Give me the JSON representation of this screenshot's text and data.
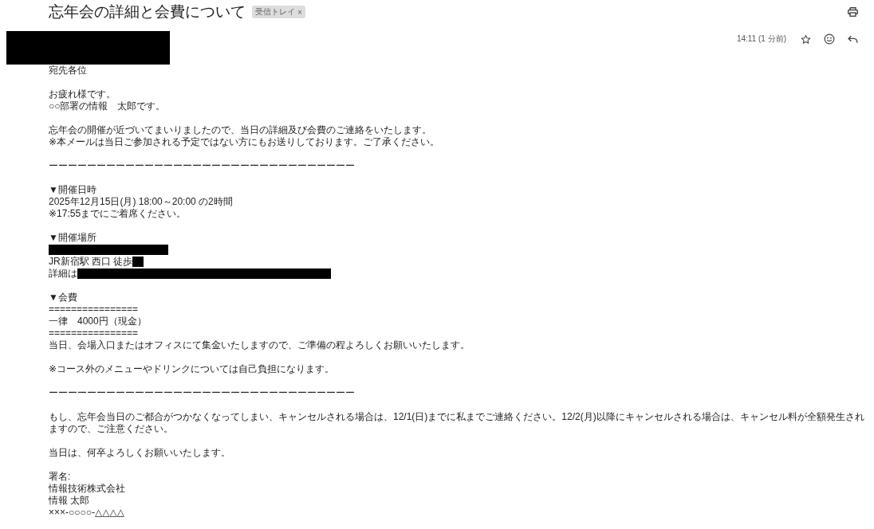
{
  "subject": "忘年会の詳細と会費について",
  "tag": {
    "label": "受信トレイ",
    "remove": "×"
  },
  "sender": {
    "redacted": true
  },
  "time": "14:11 (1 分前)",
  "starred": false,
  "body": [
    [
      {
        "text": "宛先各位"
      }
    ],
    [
      {
        "text": "お疲れ様です。"
      },
      {
        "text": "○○部署の情報　太郎です。"
      }
    ],
    [
      {
        "text": "忘年会の開催が近づいてまいりましたので、当日の詳細及び会費のご連絡をいたします。"
      },
      {
        "text": "※本メールは当日ご参加される予定ではない方にもお送りしております。ご了承ください。"
      }
    ],
    [
      {
        "text": "ーーーーーーーーーーーーーーーーーーーーーーーーーーーーーーーー"
      }
    ],
    [
      {
        "text": "▼開催日時"
      },
      {
        "text": "2025年12月15日(月) 18:00～20:00 の2時間"
      },
      {
        "text": "※17:55までにご着席ください。"
      }
    ],
    [
      {
        "text": "▼開催場所"
      },
      {
        "redacted": true
      },
      {
        "text": "JR新宿駅 西口 徒歩",
        "redacted": true
      },
      {
        "text": "詳細は",
        "redacted": true
      }
    ],
    [
      {
        "text": "▼会費"
      },
      {
        "text": "================"
      },
      {
        "text": "一律　4000円（現金）"
      },
      {
        "text": "================"
      },
      {
        "text": "当日、会場入口またはオフィスにて集金いたしますので、ご準備の程よろしくお願いいたします。"
      }
    ],
    [
      {
        "text": "※コース外のメニューやドリンクについては自己負担になります。"
      }
    ],
    [
      {
        "text": "ーーーーーーーーーーーーーーーーーーーーーーーーーーーーーーーー"
      }
    ],
    [
      {
        "text": "もし、忘年会当日のご都合がつかなくなってしまい、キャンセルされる場合は、12/1(日)までに私までご連絡ください。12/2(月)以降にキャンセルされる場合は、キャンセル料が全額発生されますので、ご注意ください。"
      }
    ],
    [
      {
        "text": "当日は、何卒よろしくお願いいたします。"
      }
    ],
    [
      {
        "text": "署名:"
      },
      {
        "text": "情報技術株式会社"
      },
      {
        "text": "情報 太郎"
      },
      {
        "text": "×××-○○○○-△△△△"
      }
    ]
  ]
}
